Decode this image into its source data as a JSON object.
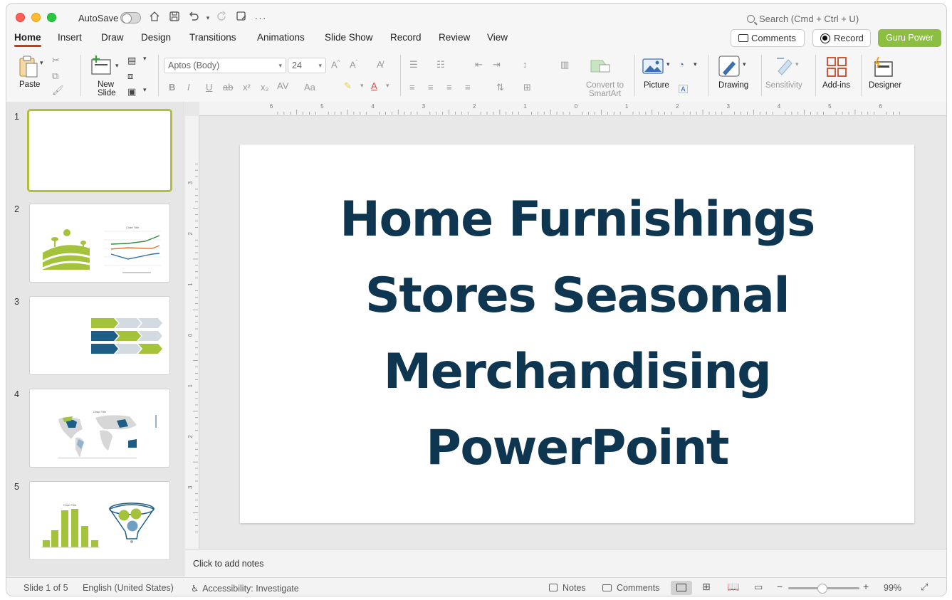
{
  "titlebar": {
    "autosave_label": "AutoSave",
    "search_placeholder": "Search (Cmd + Ctrl + U)"
  },
  "tabs": [
    "Home",
    "Insert",
    "Draw",
    "Design",
    "Transitions",
    "Animations",
    "Slide Show",
    "Record",
    "Review",
    "View"
  ],
  "active_tab": "Home",
  "header_buttons": {
    "comments": "Comments",
    "record": "Record",
    "guru": "Guru Power"
  },
  "ribbon": {
    "paste": "Paste",
    "new_slide_line1": "New",
    "new_slide_line2": "Slide",
    "font_name": "Aptos (Body)",
    "font_size": "24",
    "convert_line1": "Convert to",
    "convert_line2": "SmartArt",
    "picture": "Picture",
    "drawing": "Drawing",
    "sensitivity": "Sensitivity",
    "addins": "Add-ins",
    "designer": "Designer"
  },
  "slides": [
    {
      "number": "1"
    },
    {
      "number": "2",
      "chart_title": "Chart Title"
    },
    {
      "number": "3"
    },
    {
      "number": "4",
      "chart_title": "Chart Title"
    },
    {
      "number": "5",
      "chart_title": "Chart Title"
    }
  ],
  "main_slide": {
    "title_lines": [
      "Home Furnishings",
      "Stores Seasonal",
      "Merchandising",
      "PowerPoint"
    ]
  },
  "ruler": {
    "h_labels": [
      "6",
      "5",
      "4",
      "3",
      "2",
      "1",
      "0",
      "1",
      "2",
      "3",
      "4",
      "5",
      "6"
    ],
    "v_labels": [
      "3",
      "2",
      "1",
      "0",
      "1",
      "2",
      "3"
    ]
  },
  "notes": {
    "placeholder": "Click to add notes"
  },
  "status": {
    "slide_info": "Slide 1 of 5",
    "language": "English (United States)",
    "accessibility": "Accessibility: Investigate",
    "notes": "Notes",
    "comments": "Comments",
    "zoom": "99%"
  },
  "colors": {
    "accent_green": "#8cbf3f",
    "title_navy": "#0e3650",
    "tab_underline": "#c43e1c",
    "thumb_selected": "#b1bf3a"
  }
}
